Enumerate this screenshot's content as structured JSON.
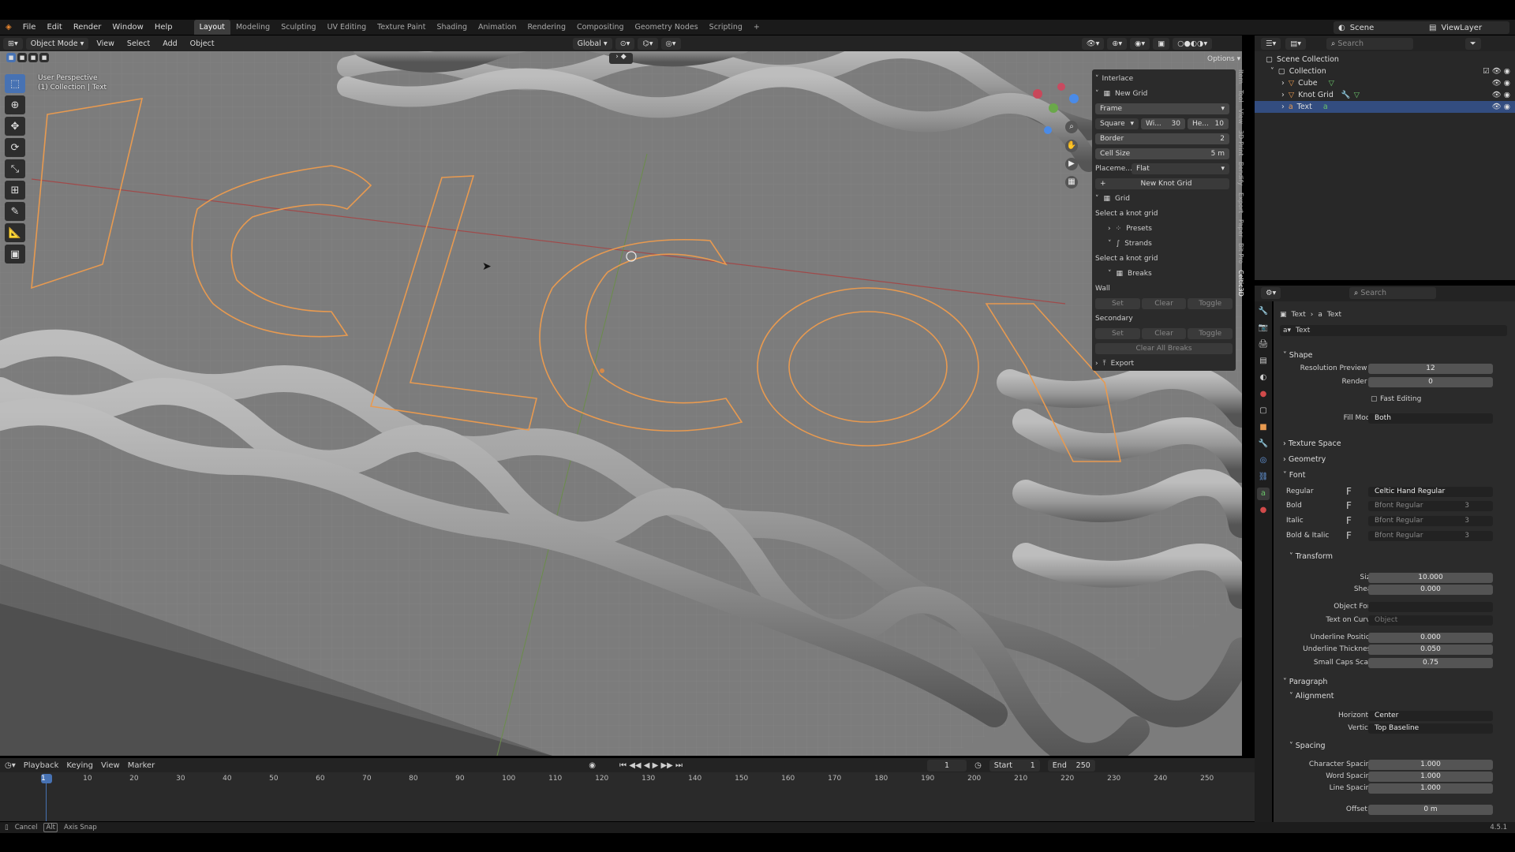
{
  "topbar": {
    "menu": [
      "File",
      "Edit",
      "Render",
      "Window",
      "Help"
    ],
    "workspaces": [
      "Layout",
      "Modeling",
      "Sculpting",
      "UV Editing",
      "Texture Paint",
      "Shading",
      "Animation",
      "Rendering",
      "Compositing",
      "Geometry Nodes",
      "Scripting"
    ],
    "active_workspace": "Layout",
    "scene": "Scene",
    "view_layer": "ViewLayer"
  },
  "viewport_header": {
    "mode": "Object Mode",
    "menus": [
      "View",
      "Select",
      "Add",
      "Object"
    ],
    "orientation": "Global",
    "options": "Options"
  },
  "viewport": {
    "perspective": "User Perspective",
    "context": "(1) Collection | Text",
    "text_letters": "WELCOM",
    "accent": "#e89a50"
  },
  "npanel": {
    "header": "Interlace",
    "new_grid": "New Grid",
    "frame": "Frame",
    "shape": "Square",
    "width_label": "Wi...",
    "width_value": "30",
    "height_label": "He...",
    "height_value": "10",
    "border_label": "Border",
    "border_value": "2",
    "cell_label": "Cell Size",
    "cell_value": "5 m",
    "placement_label": "Placeme...",
    "placement_value": "Flat",
    "new_knot_grid": "New Knot Grid",
    "grid": "Grid",
    "select_hint1": "Select a knot grid",
    "presets": "Presets",
    "strands": "Strands",
    "select_hint2": "Select a knot grid",
    "breaks": "Breaks",
    "wall": "Wall",
    "secondary": "Secondary",
    "set": "Set",
    "clear": "Clear",
    "toggle": "Toggle",
    "clear_all": "Clear All Breaks",
    "export": "Export",
    "tabs": [
      "Item",
      "Tool",
      "View",
      "3D-Print",
      "Bendify",
      "Export",
      "Paper",
      "Bit Pro",
      "Celtic3D"
    ]
  },
  "outliner": {
    "search_placeholder": "Search",
    "scene_collection": "Scene Collection",
    "collection": "Collection",
    "items": [
      "Cube",
      "Knot Grid",
      "Text"
    ]
  },
  "properties": {
    "search_placeholder": "Search",
    "breadcrumb_obj": "Text",
    "breadcrumb_data": "Text",
    "datablock": "Text",
    "shape": "Shape",
    "res_preview_label": "Resolution Preview U",
    "res_preview_value": "12",
    "render_u_label": "Render U",
    "render_u_value": "0",
    "fast_editing": "Fast Editing",
    "fill_mode_label": "Fill Mode",
    "fill_mode_value": "Both",
    "texture_space": "Texture Space",
    "geometry": "Geometry",
    "font": "Font",
    "regular_label": "Regular",
    "regular_value": "Celtic Hand Regular",
    "bold_label": "Bold",
    "italic_label": "Italic",
    "bolditalic_label": "Bold & Italic",
    "bfont": "Bfont Regular",
    "bfont_users": "3",
    "transform": "Transform",
    "size_label": "Size",
    "size_value": "10.000",
    "shear_label": "Shear",
    "shear_value": "0.000",
    "object_font_label": "Object Font",
    "text_on_curve_label": "Text on Curve",
    "text_on_curve_value": "Object",
    "ul_pos_label": "Underline Position",
    "ul_pos_value": "0.000",
    "ul_thick_label": "Underline Thickness",
    "ul_thick_value": "0.050",
    "small_caps_label": "Small Caps Scale",
    "small_caps_value": "0.75",
    "paragraph": "Paragraph",
    "alignment": "Alignment",
    "horizontal_label": "Horizontal",
    "horizontal_value": "Center",
    "vertical_label": "Vertical",
    "vertical_value": "Top Baseline",
    "spacing": "Spacing",
    "char_spacing_label": "Character Spacing",
    "char_spacing_value": "1.000",
    "word_spacing_label": "Word Spacing",
    "word_spacing_value": "1.000",
    "line_spacing_label": "Line Spacing",
    "line_spacing_value": "1.000",
    "offset_x_label": "Offset X",
    "offset_x_value": "0 m"
  },
  "timeline": {
    "menus": [
      "Playback",
      "Keying",
      "View",
      "Marker"
    ],
    "current_frame": "1",
    "start_label": "Start",
    "start_value": "1",
    "end_label": "End",
    "end_value": "250",
    "ticks": [
      "1",
      "10",
      "20",
      "30",
      "40",
      "50",
      "60",
      "70",
      "80",
      "90",
      "100",
      "110",
      "120",
      "130",
      "140",
      "150",
      "160",
      "170",
      "180",
      "190",
      "200",
      "210",
      "220",
      "230",
      "240",
      "250"
    ]
  },
  "status": {
    "cancel": "Cancel",
    "alt": "Alt",
    "axis_snap": "Axis Snap",
    "version": "4.5.1"
  }
}
